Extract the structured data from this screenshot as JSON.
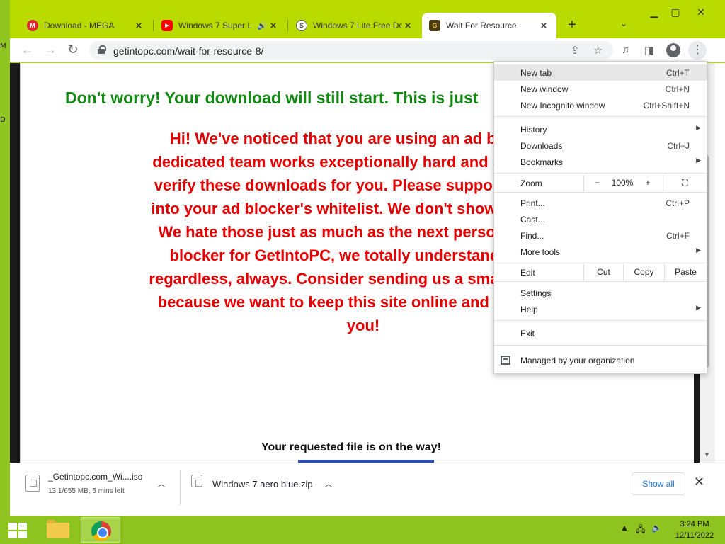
{
  "desktop": {
    "fragments": [
      "M",
      "D"
    ]
  },
  "tabs": [
    {
      "title": "Download - MEGA",
      "favicon": "mega-icon",
      "color": "#d9272e",
      "glyph": "M"
    },
    {
      "title": "Windows 7 Super L",
      "favicon": "youtube-icon",
      "color": "#ff0000",
      "glyph": "▶",
      "audio": "🔊"
    },
    {
      "title": "Windows 7 Lite Free Do",
      "favicon": "globe-icon",
      "color": "#777777",
      "glyph": "S"
    },
    {
      "title": "Wait For Resource",
      "favicon": "getintopc-icon",
      "color": "#4a3b12",
      "glyph": "G"
    }
  ],
  "toolbar": {
    "url": "getintopc.com/wait-for-resource-8/"
  },
  "page": {
    "green_heading": "Don't worry! Your download will still start. This is just",
    "red_lines": [
      "Hi! We've noticed that you are using an ad blocker :(",
      "dedicated team works exceptionally hard and spends loa",
      "verify these downloads for you. Please support our effor",
      "into your ad blocker's whitelist. We don't show any pop-u",
      "We hate those just as much as the next person. If you c",
      "blocker for GetIntoPC, we totally understand! Your d",
      "regardless, always. Consider sending us a small donation",
      "because we want to keep this site online and free for as",
      "you!"
    ],
    "requested": "Your requested file is on the way!"
  },
  "menu": {
    "new_tab": {
      "label": "New tab",
      "shortcut": "Ctrl+T"
    },
    "new_window": {
      "label": "New window",
      "shortcut": "Ctrl+N"
    },
    "new_incognito": {
      "label": "New Incognito window",
      "shortcut": "Ctrl+Shift+N"
    },
    "history": {
      "label": "History"
    },
    "downloads": {
      "label": "Downloads",
      "shortcut": "Ctrl+J"
    },
    "bookmarks": {
      "label": "Bookmarks"
    },
    "zoom": {
      "label": "Zoom",
      "minus": "−",
      "value": "100%",
      "plus": "+"
    },
    "print": {
      "label": "Print...",
      "shortcut": "Ctrl+P"
    },
    "cast": {
      "label": "Cast..."
    },
    "find": {
      "label": "Find...",
      "shortcut": "Ctrl+F"
    },
    "more_tools": {
      "label": "More tools"
    },
    "edit": {
      "label": "Edit",
      "cut": "Cut",
      "copy": "Copy",
      "paste": "Paste"
    },
    "settings": {
      "label": "Settings"
    },
    "help": {
      "label": "Help"
    },
    "exit": {
      "label": "Exit"
    },
    "managed": {
      "label": "Managed by your organization"
    }
  },
  "downloads_shelf": {
    "items": [
      {
        "name": "_Getintopc.com_Wi....iso",
        "status": "13.1/655 MB, 5 mins left"
      },
      {
        "name": "Windows 7 aero blue.zip",
        "status": ""
      }
    ],
    "show_all": "Show all"
  },
  "taskbar": {
    "time": "3:24 PM",
    "date": "12/11/2022"
  }
}
